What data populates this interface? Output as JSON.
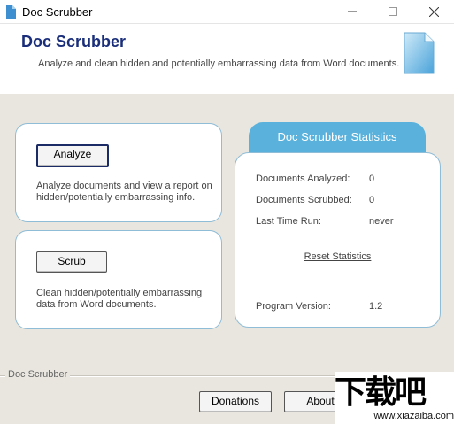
{
  "window": {
    "title": "Doc Scrubber",
    "controls": {
      "minimize": "–",
      "maximize": "☐",
      "close": "✕"
    }
  },
  "header": {
    "title": "Doc Scrubber",
    "subtitle": "Analyze and clean hidden and potentially embarrassing data from Word documents."
  },
  "analyze": {
    "button_label": "Analyze",
    "description": "Analyze documents and view a report on hidden/potentially embarrassing info."
  },
  "scrub": {
    "button_label": "Scrub",
    "description": "Clean hidden/potentially embarrassing data from Word documents."
  },
  "stats": {
    "title": "Doc Scrubber Statistics",
    "documents_analyzed_label": "Documents Analyzed:",
    "documents_analyzed_value": "0",
    "documents_scrubbed_label": "Documents Scrubbed:",
    "documents_scrubbed_value": "0",
    "last_time_run_label": "Last Time Run:",
    "last_time_run_value": "never",
    "reset_label": "Reset Statistics",
    "version_label": "Program Version:",
    "version_value": "1.2"
  },
  "footer": {
    "group_label": "Doc Scrubber",
    "donations_label": "Donations",
    "about_label": "About"
  },
  "watermark": {
    "logo_text": "下载吧",
    "url": "www.xiazaiba.com"
  },
  "colors": {
    "accent": "#5ab2dc",
    "title_blue": "#1a2e7a",
    "panel_border": "#8fbcd6",
    "background": "#e8e6df"
  }
}
